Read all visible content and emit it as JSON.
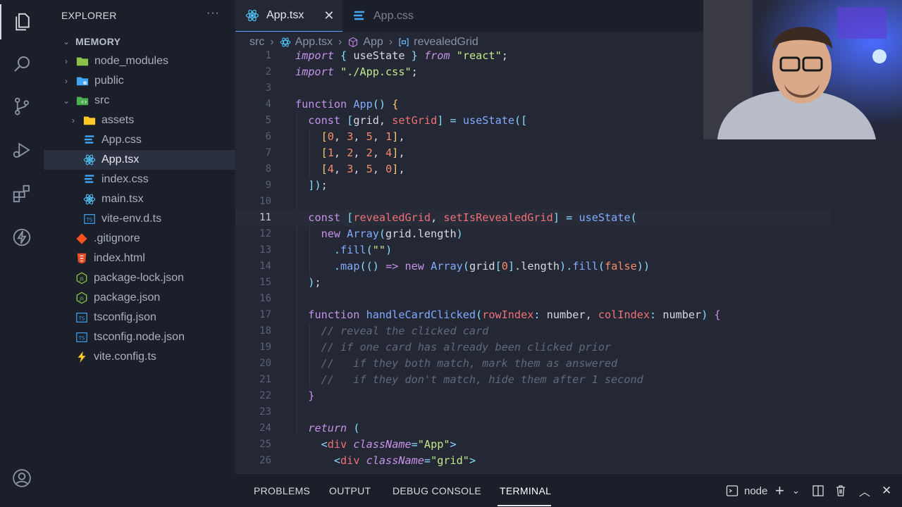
{
  "sidebar": {
    "header": "EXPLORER",
    "more": "···",
    "section": "MEMORY",
    "items": [
      {
        "label": "node_modules",
        "icon": "folder-node-icon"
      },
      {
        "label": "public",
        "icon": "folder-public-icon"
      },
      {
        "label": "src",
        "icon": "folder-src-icon"
      },
      {
        "label": "assets",
        "icon": "folder-icon"
      },
      {
        "label": "App.css",
        "icon": "css-file-icon"
      },
      {
        "label": "App.tsx",
        "icon": "react-file-icon"
      },
      {
        "label": "index.css",
        "icon": "css-file-icon"
      },
      {
        "label": "main.tsx",
        "icon": "react-file-icon"
      },
      {
        "label": "vite-env.d.ts",
        "icon": "ts-file-icon"
      },
      {
        "label": ".gitignore",
        "icon": "git-file-icon"
      },
      {
        "label": "index.html",
        "icon": "html-file-icon"
      },
      {
        "label": "package-lock.json",
        "icon": "nodejs-file-icon"
      },
      {
        "label": "package.json",
        "icon": "nodejs-file-icon"
      },
      {
        "label": "tsconfig.json",
        "icon": "tsconfig-file-icon"
      },
      {
        "label": "tsconfig.node.json",
        "icon": "tsconfig-file-icon"
      },
      {
        "label": "vite.config.ts",
        "icon": "vite-file-icon"
      }
    ]
  },
  "tabs": [
    {
      "label": "App.tsx",
      "active": true
    },
    {
      "label": "App.css",
      "active": false
    }
  ],
  "breadcrumb": {
    "src": "src",
    "file": "App.tsx",
    "component": "App",
    "symbol": "revealedGrid"
  },
  "editor": {
    "line_numbers": [
      "1",
      "2",
      "3",
      "4",
      "5",
      "6",
      "7",
      "8",
      "9",
      "10",
      "11",
      "12",
      "13",
      "14",
      "15",
      "16",
      "17",
      "18",
      "19",
      "20",
      "21",
      "22",
      "23",
      "24",
      "25",
      "26"
    ],
    "current_line": "11"
  },
  "panel": {
    "tabs": [
      "PROBLEMS",
      "OUTPUT",
      "DEBUG CONSOLE",
      "TERMINAL"
    ],
    "active_tab": "TERMINAL",
    "terminal_name": "node"
  },
  "colors": {
    "background": "#232834",
    "sidebar": "#1b1f29",
    "keyword": "#c792ea",
    "function": "#82aaff",
    "string": "#c3e88d",
    "number": "#f78c6c"
  }
}
